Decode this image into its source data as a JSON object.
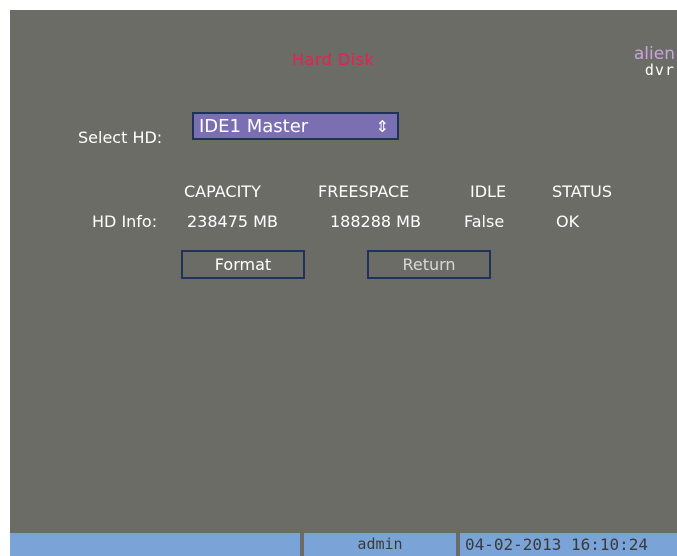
{
  "header": {
    "title": "Hard Disk",
    "logo_line1": "alien",
    "logo_line2": "dvr"
  },
  "select_hd": {
    "label": "Select  HD:",
    "value": "IDE1 Master",
    "arrow_icon": "up-down-arrows-icon"
  },
  "hd_info": {
    "row_label": "HD  Info:",
    "columns": [
      "CAPACITY",
      "FREESPACE",
      "IDLE",
      "STATUS"
    ],
    "values": [
      "238475 MB",
      "188288 MB",
      "False",
      "OK"
    ]
  },
  "buttons": {
    "format": "Format",
    "return": "Return"
  },
  "statusbar": {
    "user": "admin",
    "datetime": "04-02-2013 16:10:24"
  },
  "colors": {
    "background": "#6b6c66",
    "title": "#e8204f",
    "select_bg": "#7a6fb3",
    "border": "#1f3358",
    "statusbar": "#7aa4d8"
  }
}
